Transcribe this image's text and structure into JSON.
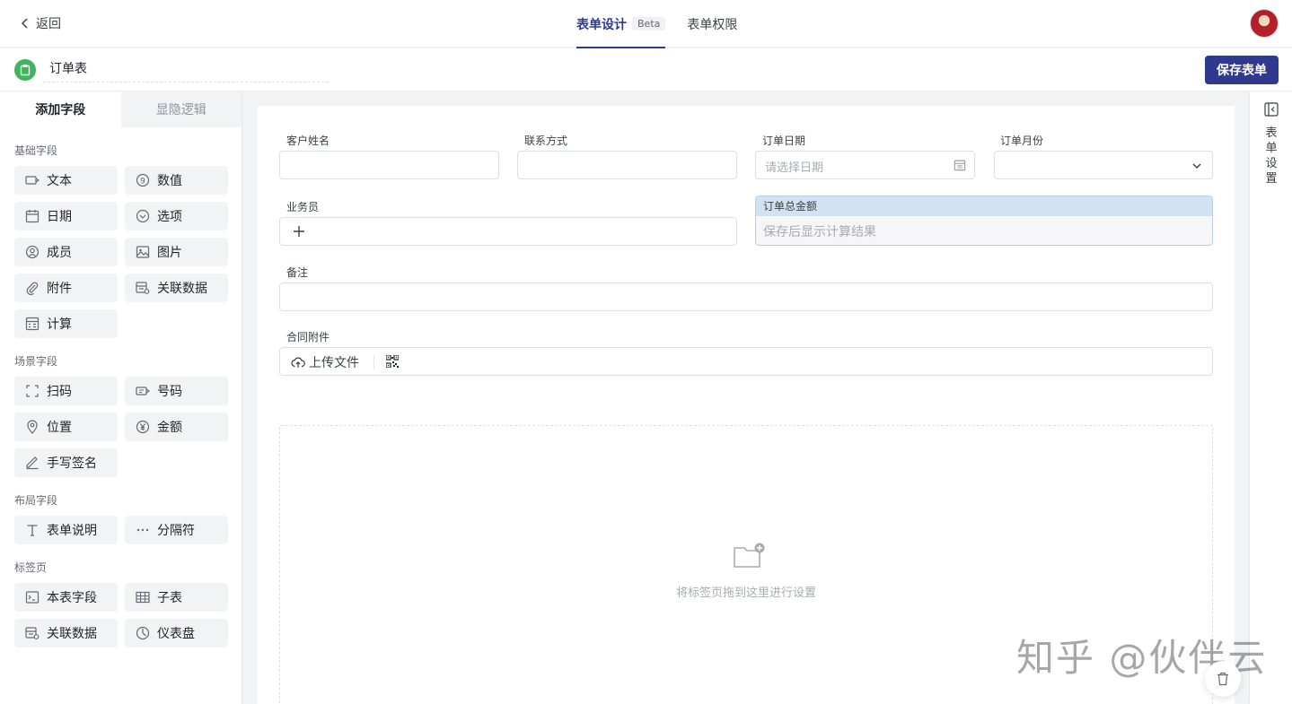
{
  "header": {
    "back_label": "返回",
    "tabs": [
      {
        "label": "表单设计",
        "badge": "Beta",
        "active": true
      },
      {
        "label": "表单权限",
        "active": false
      }
    ]
  },
  "form": {
    "name": "订单表",
    "save_label": "保存表单"
  },
  "sidebar": {
    "tabs": [
      {
        "label": "添加字段"
      },
      {
        "label": "显隐逻辑"
      }
    ],
    "groups": [
      {
        "title": "基础字段",
        "items": [
          {
            "label": "文本",
            "icon": "text-field-icon"
          },
          {
            "label": "数值",
            "icon": "number-icon"
          },
          {
            "label": "日期",
            "icon": "calendar-icon"
          },
          {
            "label": "选项",
            "icon": "option-icon"
          },
          {
            "label": "成员",
            "icon": "member-icon"
          },
          {
            "label": "图片",
            "icon": "image-icon"
          },
          {
            "label": "附件",
            "icon": "attachment-icon"
          },
          {
            "label": "关联数据",
            "icon": "linked-data-icon"
          },
          {
            "label": "计算",
            "icon": "calculator-icon"
          }
        ]
      },
      {
        "title": "场景字段",
        "items": [
          {
            "label": "扫码",
            "icon": "scan-icon"
          },
          {
            "label": "号码",
            "icon": "phone-number-icon"
          },
          {
            "label": "位置",
            "icon": "location-icon"
          },
          {
            "label": "金额",
            "icon": "yen-icon"
          },
          {
            "label": "手写签名",
            "icon": "signature-icon"
          }
        ]
      },
      {
        "title": "布局字段",
        "items": [
          {
            "label": "表单说明",
            "icon": "text-t-icon"
          },
          {
            "label": "分隔符",
            "icon": "ellipsis-icon"
          }
        ]
      },
      {
        "title": "标签页",
        "items": [
          {
            "label": "本表字段",
            "icon": "form-field-icon"
          },
          {
            "label": "子表",
            "icon": "table-icon"
          },
          {
            "label": "关联数据",
            "icon": "linked-data-icon"
          },
          {
            "label": "仪表盘",
            "icon": "dashboard-icon"
          }
        ]
      }
    ]
  },
  "canvas": {
    "fields": {
      "customer_name": {
        "label": "客户姓名"
      },
      "contact": {
        "label": "联系方式"
      },
      "order_date": {
        "label": "订单日期",
        "placeholder": "请选择日期"
      },
      "order_month": {
        "label": "订单月份"
      },
      "salesperson": {
        "label": "业务员"
      },
      "total_amount": {
        "label": "订单总金额",
        "placeholder": "保存后显示计算结果"
      },
      "remark": {
        "label": "备注"
      },
      "contract_attachment": {
        "label": "合同附件",
        "upload_label": "上传文件"
      }
    },
    "dropzone_text": "将标签页拖到这里进行设置"
  },
  "right_rail": {
    "label": "表单设置"
  },
  "watermark": "知乎 @伙伴云",
  "colors": {
    "primary": "#2f3a8f",
    "form_icon": "#3fb45a",
    "calc_header": "#d3e2f2"
  }
}
